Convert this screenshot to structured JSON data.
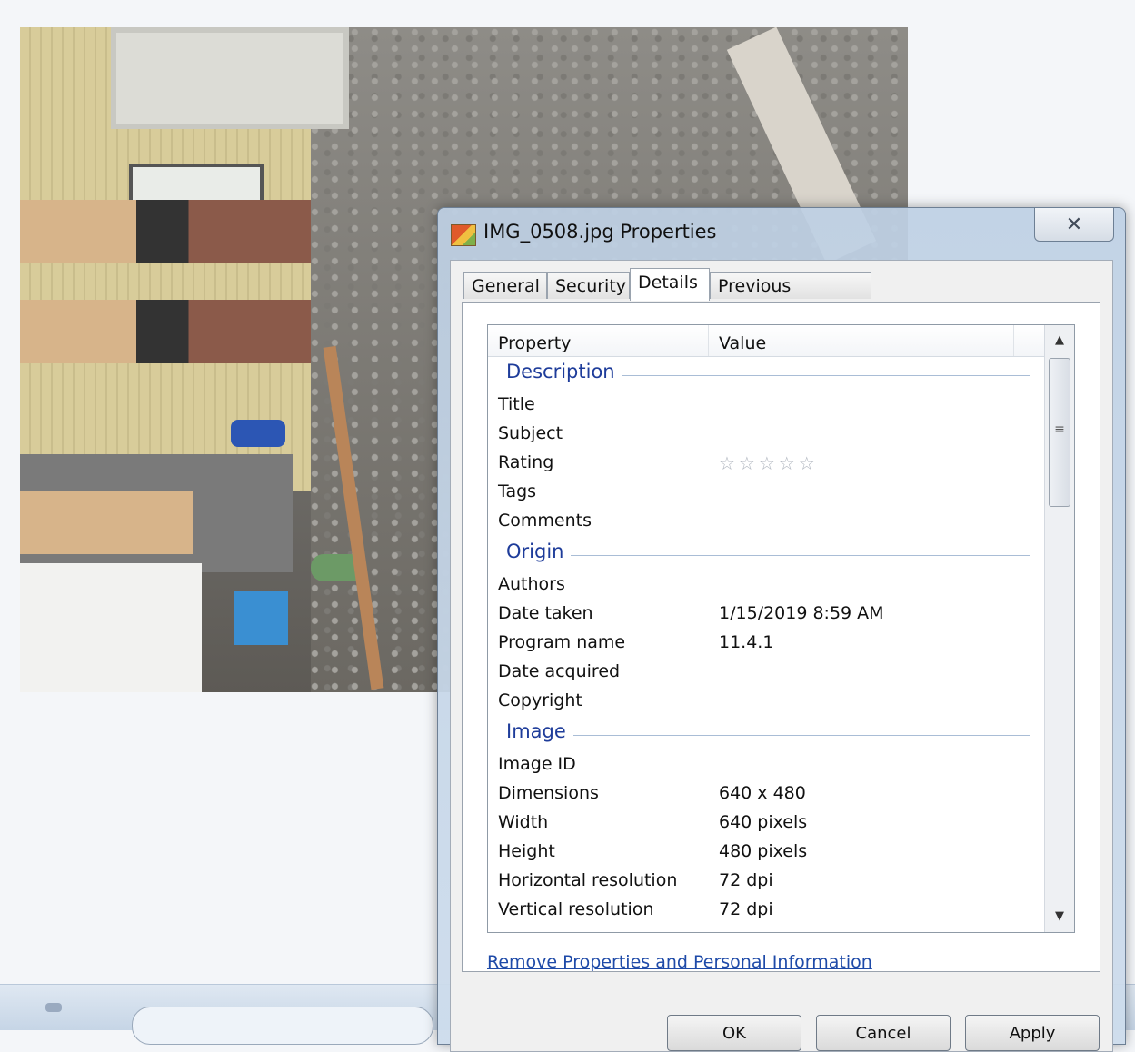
{
  "dialog": {
    "title": "IMG_0508.jpg Properties",
    "close_symbol": "✕"
  },
  "tabs": [
    {
      "label": "General"
    },
    {
      "label": "Security"
    },
    {
      "label": "Details"
    },
    {
      "label": "Previous Versions"
    }
  ],
  "columns": {
    "property": "Property",
    "value": "Value"
  },
  "groups": {
    "description": {
      "label": "Description",
      "rows": [
        {
          "property": "Title",
          "value": ""
        },
        {
          "property": "Subject",
          "value": ""
        },
        {
          "property": "Rating",
          "value": "☆☆☆☆☆"
        },
        {
          "property": "Tags",
          "value": ""
        },
        {
          "property": "Comments",
          "value": ""
        }
      ]
    },
    "origin": {
      "label": "Origin",
      "rows": [
        {
          "property": "Authors",
          "value": ""
        },
        {
          "property": "Date taken",
          "value": "1/15/2019 8:59 AM"
        },
        {
          "property": "Program name",
          "value": "11.4.1"
        },
        {
          "property": "Date acquired",
          "value": ""
        },
        {
          "property": "Copyright",
          "value": ""
        }
      ]
    },
    "image": {
      "label": "Image",
      "rows": [
        {
          "property": "Image ID",
          "value": ""
        },
        {
          "property": "Dimensions",
          "value": "640 x 480"
        },
        {
          "property": "Width",
          "value": "640 pixels"
        },
        {
          "property": "Height",
          "value": "480 pixels"
        },
        {
          "property": "Horizontal resolution",
          "value": "72 dpi"
        },
        {
          "property": "Vertical resolution",
          "value": "72 dpi"
        }
      ]
    }
  },
  "scrollbar": {
    "up": "▲",
    "down": "▼",
    "grip": "≡"
  },
  "remove_link": "Remove Properties and Personal Information",
  "buttons": {
    "ok": "OK",
    "cancel": "Cancel",
    "apply": "Apply"
  },
  "icons": {
    "close": "close-icon",
    "rating": "star-icon",
    "title": "image-file-icon"
  }
}
